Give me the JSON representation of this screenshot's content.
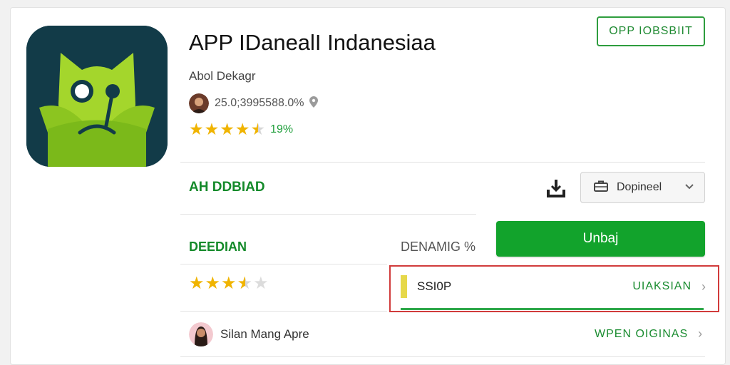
{
  "app": {
    "title": "APP IDanealI Indanesiaa",
    "developer": "Abol Dekagr",
    "meta_text": "25.0;3995588.0%",
    "rating_pct": "19%"
  },
  "header": {
    "top_button_label": "OPP IOBSBIIT"
  },
  "section": {
    "title": "AH DDBIAD"
  },
  "toolbar": {
    "select_label": "Dopineel"
  },
  "install": {
    "label": "Unbaj"
  },
  "columns": {
    "left_label": "DEEDIAN",
    "right_label": "DENAMIG %"
  },
  "version_row": {
    "text": "SSI0P",
    "link_label": "UIAKSIAN"
  },
  "reviewer": {
    "name": "Silan Mang Apre",
    "link_label": "WPEN OIGINAS"
  },
  "ratings": {
    "top_stars": 4.5,
    "bottom_stars": 3.5
  },
  "colors": {
    "accent_green": "#12a32c",
    "highlight_red": "#d13b3b",
    "star_gold": "#f0b400"
  },
  "icons": [
    "app-logo-icon",
    "location-pin-icon",
    "download-icon",
    "briefcase-icon",
    "chevron-down-icon",
    "chevron-right-icon"
  ]
}
